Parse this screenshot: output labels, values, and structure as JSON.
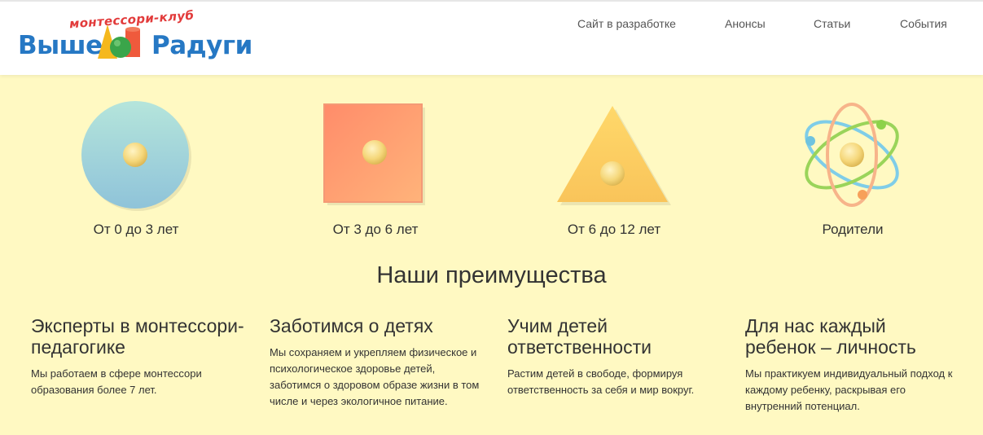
{
  "brand": {
    "small": "монтессори-клуб",
    "word1": "Выше",
    "word2": "Радуги",
    "colors": {
      "blue": "#2678c4",
      "red": "#e23b3b"
    }
  },
  "nav": [
    {
      "label": "Сайт в разработке"
    },
    {
      "label": "Анонсы"
    },
    {
      "label": "Статьи"
    },
    {
      "label": "События"
    }
  ],
  "ages": [
    {
      "label": "От 0 до 3 лет",
      "icon": "circle-icon"
    },
    {
      "label": "От 3 до 6 лет",
      "icon": "square-icon"
    },
    {
      "label": "От 6 до 12 лет",
      "icon": "triangle-icon"
    },
    {
      "label": "Родители",
      "icon": "atom-icon"
    }
  ],
  "advantages": {
    "title": "Наши преимущества",
    "items": [
      {
        "title": "Эксперты в монтессори-педагогике",
        "text": "Мы работаем в сфере монтессори образования более 7 лет."
      },
      {
        "title": "Заботимся о детях",
        "text": "Мы сохраняем и укрепляем физическое и психологическое здоровье детей, заботимся о здоровом образе жизни в том числе и через экологичное питание."
      },
      {
        "title": "Учим детей ответственности",
        "text": "Растим детей в свободе, формируя ответственность за себя и мир вокруг."
      },
      {
        "title": "Для нас каждый ребенок – личность",
        "text": "Мы практикуем индивидуальный подход к каждому ребенку, раскрывая его внутренний потенциал."
      }
    ]
  },
  "theme": {
    "background": "#fff9c2",
    "header": "#ffffff"
  }
}
